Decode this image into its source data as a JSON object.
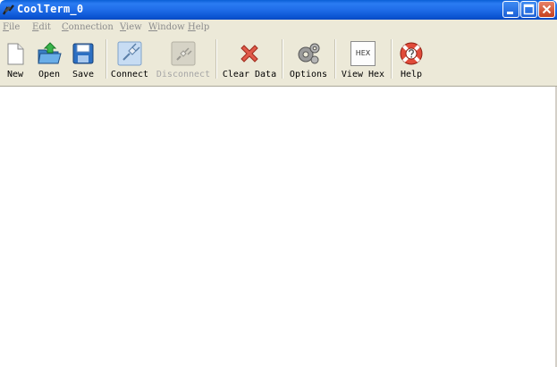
{
  "window": {
    "title": "CoolTerm_0",
    "app_icon": "coolterm-app-icon",
    "controls": [
      "minimize-icon",
      "maximize-icon",
      "close-icon"
    ]
  },
  "menu": [
    {
      "first": "F",
      "rest": "ile"
    },
    {
      "first": "E",
      "rest": "dit"
    },
    {
      "first": "C",
      "rest": "onnection"
    },
    {
      "first": "V",
      "rest": "iew"
    },
    {
      "first": "W",
      "rest": "indow"
    },
    {
      "first": "H",
      "rest": "elp"
    }
  ],
  "toolbar": {
    "new": {
      "label": "New",
      "icon": "new-document-icon"
    },
    "open": {
      "label": "Open",
      "icon": "open-folder-icon"
    },
    "save": {
      "label": "Save",
      "icon": "save-floppy-icon"
    },
    "connect": {
      "label": "Connect",
      "icon": "connect-plug-icon"
    },
    "disconnect": {
      "label": "Disconnect",
      "icon": "disconnect-plug-icon",
      "enabled": false
    },
    "clear": {
      "label": "Clear Data",
      "icon": "clear-x-icon"
    },
    "options": {
      "label": "Options",
      "icon": "gears-icon"
    },
    "viewhex": {
      "label": "View Hex",
      "icon": "hex-icon",
      "icon_text": "HEX"
    },
    "help": {
      "label": "Help",
      "icon": "help-lifebuoy-icon"
    }
  },
  "colors": {
    "titlebar": "#0a5fd6",
    "toolbar_bg": "#ece9d8",
    "content_bg": "#ffffff",
    "disabled_text": "#a6a6a6"
  }
}
